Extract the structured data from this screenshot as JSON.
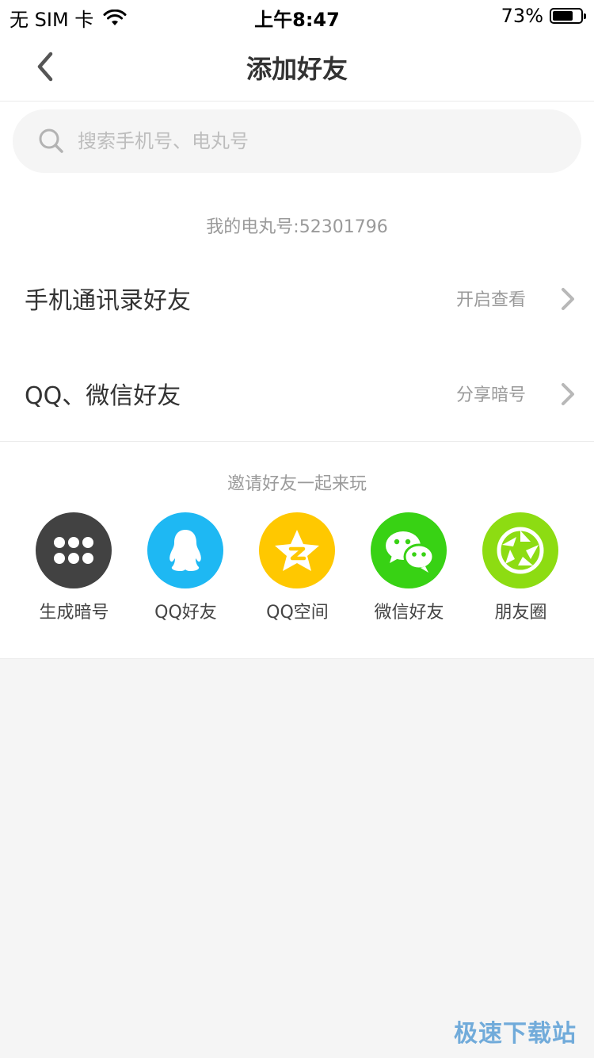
{
  "status_bar": {
    "carrier": "无 SIM 卡",
    "time": "上午8:47",
    "battery_pct": "73%",
    "battery_level": 0.73
  },
  "nav": {
    "title": "添加好友"
  },
  "search": {
    "placeholder": "搜索手机号、电丸号",
    "value": ""
  },
  "my_id": "我的电丸号:52301796",
  "rows": [
    {
      "title": "手机通讯录好友",
      "action": "开启查看"
    },
    {
      "title": "QQ、微信好友",
      "action": "分享暗号"
    }
  ],
  "invite": {
    "title": "邀请好友一起来玩",
    "items": [
      {
        "label": "生成暗号",
        "icon": "dots-grid-icon",
        "color": "#424242"
      },
      {
        "label": "QQ好友",
        "icon": "qq-penguin-icon",
        "color": "#1eb8f3"
      },
      {
        "label": "QQ空间",
        "icon": "qzone-star-icon",
        "color": "#ffc800"
      },
      {
        "label": "微信好友",
        "icon": "wechat-icon",
        "color": "#38d214"
      },
      {
        "label": "朋友圈",
        "icon": "moments-shutter-icon",
        "color": "#8ddc12"
      }
    ]
  },
  "watermark": "极速下载站"
}
